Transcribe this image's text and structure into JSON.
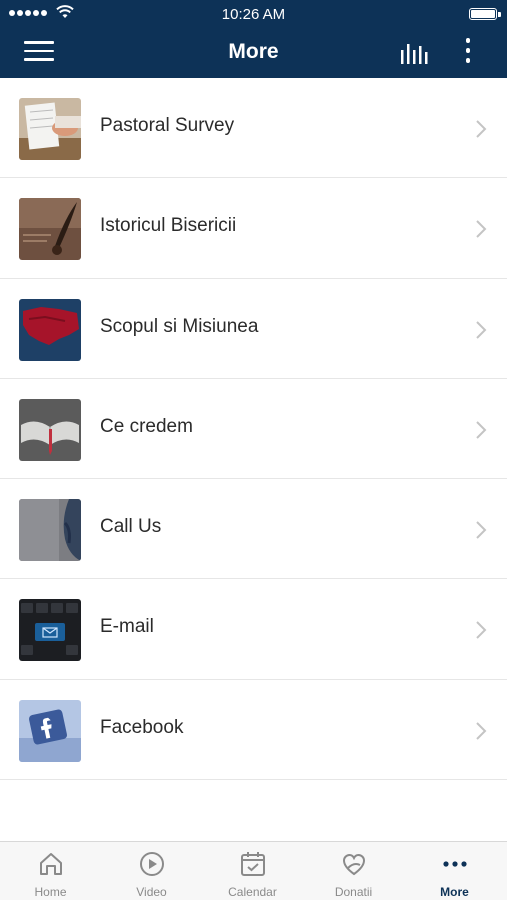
{
  "status_bar": {
    "time": "10:26 AM"
  },
  "header": {
    "title": "More"
  },
  "list": {
    "items": [
      {
        "label": "Pastoral Survey",
        "icon": "survey-photo"
      },
      {
        "label": "Istoricul Bisericii",
        "icon": "quill-photo"
      },
      {
        "label": "Scopul si Misiunea",
        "icon": "map-photo"
      },
      {
        "label": "Ce credem",
        "icon": "bible-photo"
      },
      {
        "label": "Call Us",
        "icon": "phone-photo"
      },
      {
        "label": "E-mail",
        "icon": "keyboard-email-photo"
      },
      {
        "label": "Facebook",
        "icon": "facebook-photo"
      }
    ]
  },
  "tabbar": {
    "tabs": [
      {
        "label": "Home",
        "icon": "home-icon"
      },
      {
        "label": "Video",
        "icon": "play-icon"
      },
      {
        "label": "Calendar",
        "icon": "calendar-icon"
      },
      {
        "label": "Donatii",
        "icon": "donation-icon"
      },
      {
        "label": "More",
        "icon": "more-dots-icon",
        "active": true
      }
    ]
  },
  "colors": {
    "header": "#0d3257",
    "accent": "#0d3257",
    "tab_inactive": "#8a8a8a"
  }
}
